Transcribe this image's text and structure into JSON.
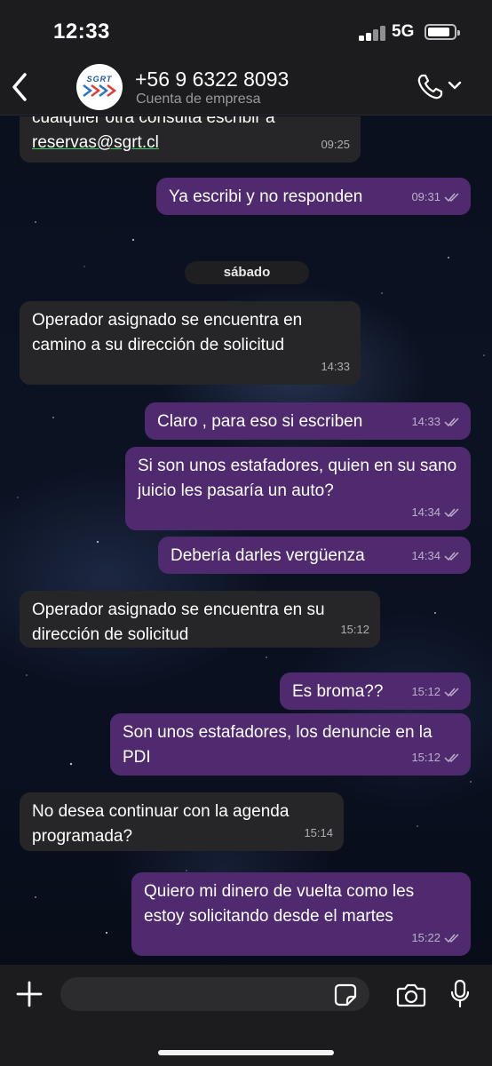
{
  "status_bar": {
    "time": "12:33",
    "network": "5G"
  },
  "header": {
    "avatar_text": "SGRT",
    "contact_name": "+56 9 6322 8093",
    "contact_subtitle": "Cuenta de empresa"
  },
  "date_separator": "sábado",
  "messages": [
    {
      "direction": "in",
      "text_line1": "cualquier otra consulta escribir a",
      "link": "reservas@sgrt.cl",
      "time": "09:25"
    },
    {
      "direction": "out",
      "text": "Ya escribi y no responden",
      "time": "09:31"
    },
    {
      "direction": "in",
      "text": "Operador asignado se encuentra en camino a su dirección de solicitud",
      "time": "14:33"
    },
    {
      "direction": "out",
      "text": "Claro , para eso si escriben",
      "time": "14:33"
    },
    {
      "direction": "out",
      "text": "Si son unos estafadores, quien en su sano juicio les pasaría un auto?",
      "time": "14:34"
    },
    {
      "direction": "out",
      "text": "Debería darles vergüenza",
      "time": "14:34"
    },
    {
      "direction": "in",
      "text": "Operador asignado se encuentra en su dirección de solicitud",
      "time": "15:12"
    },
    {
      "direction": "out",
      "text": "Es broma??",
      "time": "15:12"
    },
    {
      "direction": "out",
      "text": "Son unos estafadores, los denuncie en la PDI",
      "time": "15:12"
    },
    {
      "direction": "in",
      "text": "No desea continuar con la agenda programada?",
      "time": "15:14"
    },
    {
      "direction": "out",
      "text": "Quiero mi dinero de vuelta como les estoy solicitando desde el martes",
      "time": "15:22"
    }
  ],
  "input": {
    "placeholder": ""
  },
  "colors": {
    "incoming_bubble": "#262628",
    "outgoing_bubble": "#4f2a6e",
    "link_underline": "#39d26b",
    "bar_background": "#1c1c1e"
  }
}
